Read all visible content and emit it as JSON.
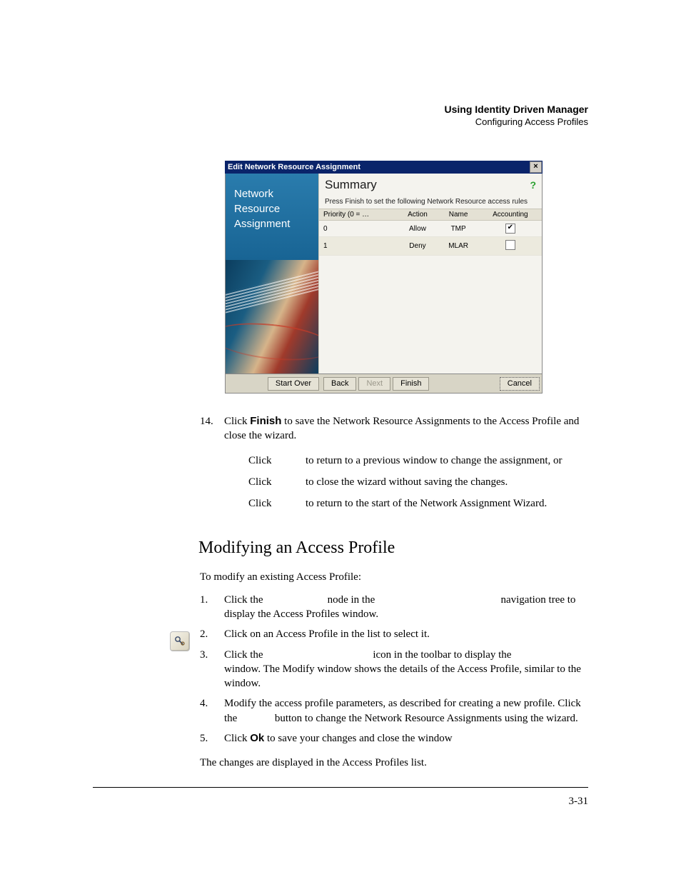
{
  "header": {
    "title": "Using Identity Driven Manager",
    "subtitle": "Configuring Access Profiles"
  },
  "dialog": {
    "title": "Edit Network Resource Assignment",
    "sidebar_heading": "Network Resource Assignment",
    "summary_heading": "Summary",
    "instruction": "Press Finish to set the following Network Resource access rules",
    "columns": {
      "priority": "Priority (0 = …",
      "action": "Action",
      "name": "Name",
      "accounting": "Accounting"
    },
    "rows": [
      {
        "priority": "0",
        "action": "Allow",
        "name": "TMP",
        "accounting": true
      },
      {
        "priority": "1",
        "action": "Deny",
        "name": "MLAR",
        "accounting": false
      }
    ],
    "buttons": {
      "start_over": "Start Over",
      "back": "Back",
      "next": "Next",
      "finish": "Finish",
      "cancel": "Cancel"
    }
  },
  "step14": {
    "number": "14.",
    "line1a": "Click ",
    "line1_bold": "Finish",
    "line1b": " to save the Network Resource Assignments to the Access Profile and close the wizard.",
    "click_label": "Click",
    "back_desc": "to return to a previous window to change the assignment, or",
    "cancel_desc": "to close the wizard without saving the changes.",
    "start_over_desc": "to return to the start of the Network Assignment Wizard."
  },
  "section_heading": "Modifying an Access Profile",
  "intro": "To modify an existing Access Profile:",
  "steps": {
    "s1_num": "1.",
    "s1": "Click the                        node in the                                               navigation tree to display the Access Profiles window.",
    "s2_num": "2.",
    "s2": "Click on an Access Profile in the list to select it.",
    "s3_num": "3.",
    "s3": "Click the                                         icon in the toolbar to display the                         window. The Modify window shows the details of the Access Profile, similar to the                                                  window.",
    "s4_num": "4.",
    "s4": "Modify the access profile parameters, as described for creating a new profile. Click the              button to change the Network Resource Assignments using the wizard.",
    "s5_num": "5.",
    "s5a": "Click ",
    "s5_bold": "Ok",
    "s5b": " to save your changes and close the window"
  },
  "closing": "The changes are displayed in the Access Profiles list.",
  "page_number": "3-31"
}
